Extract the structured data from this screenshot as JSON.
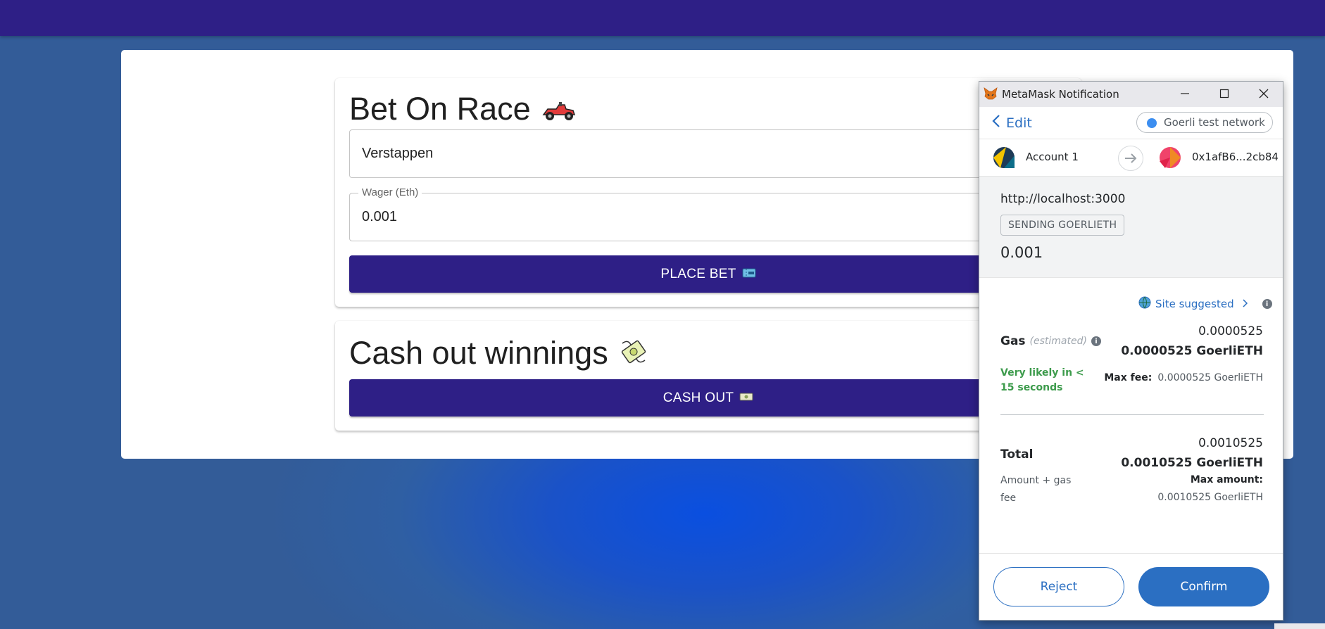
{
  "app": {
    "bet_card": {
      "title": "Bet On Race",
      "title_icon": "race-car-icon",
      "driver_value": "Verstappen",
      "wager_label": "Wager (Eth)",
      "wager_value": "0.001",
      "place_bet_label": "PLACE BET",
      "place_bet_icon": "ticket-icon"
    },
    "cashout_card": {
      "title": "Cash out winnings",
      "title_icon": "money-with-wings-icon",
      "cash_out_label": "CASH OUT",
      "cash_out_icon": "banknote-icon"
    },
    "colors": {
      "topbar": "#2e1f86",
      "button": "#2e1f86",
      "background": "#335c98"
    }
  },
  "metamask": {
    "window_title": "MetaMask Notification",
    "edit_label": "Edit",
    "network": "Goerli test network",
    "from_account": "Account 1",
    "to_account": "0x1afB6...2cb84",
    "origin": "http://localhost:3000",
    "action_badge": "SENDING GOERLIETH",
    "amount": "0.001",
    "site_suggested": "Site suggested",
    "gas": {
      "label": "Gas",
      "estimated": "(estimated)",
      "value": "0.0000525",
      "value_bold": "0.0000525 GoerliETH",
      "likely": "Very likely in < 15 seconds",
      "max_fee_label": "Max fee:",
      "max_fee_value": "0.0000525 GoerliETH"
    },
    "total": {
      "label": "Total",
      "value": "0.0010525",
      "value_bold": "0.0010525 GoerliETH",
      "amount_gas_fee": "Amount + gas fee",
      "max_amount_label": "Max amount:",
      "max_amount_value": "0.0010525 GoerliETH"
    },
    "reject_label": "Reject",
    "confirm_label": "Confirm",
    "colors": {
      "accent": "#2b6fc2",
      "success": "#3d9b4c",
      "network_dot": "#3c8ef0"
    }
  }
}
